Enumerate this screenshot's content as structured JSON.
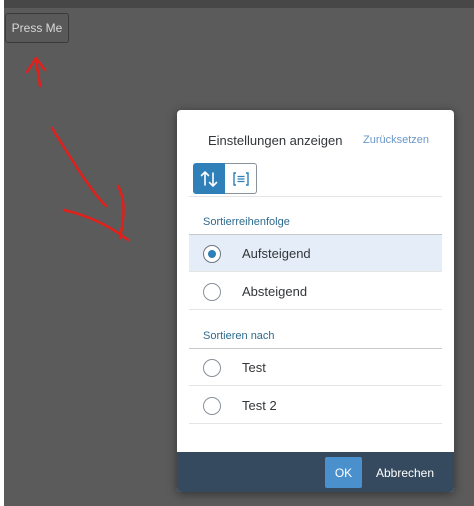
{
  "page": {
    "press_button_label": "Press Me"
  },
  "dialog": {
    "title": "Einstellungen anzeigen",
    "reset_label": "Zurücksetzen",
    "tabs": [
      {
        "icon": "sort-icon",
        "active": true
      },
      {
        "icon": "group-list-icon",
        "active": false
      }
    ],
    "sort_order": {
      "label": "Sortierreihenfolge",
      "options": [
        {
          "label": "Aufsteigend",
          "selected": true
        },
        {
          "label": "Absteigend",
          "selected": false
        }
      ]
    },
    "sort_by": {
      "label": "Sortieren nach",
      "options": [
        {
          "label": "Test",
          "selected": false
        },
        {
          "label": "Test 2",
          "selected": false
        }
      ]
    },
    "footer": {
      "ok_label": "OK",
      "cancel_label": "Abbrechen"
    }
  },
  "colors": {
    "accent": "#2f7fb8",
    "overlay": "#5b5b5b",
    "footer": "#354a5f",
    "annotation": "#e0201b"
  }
}
